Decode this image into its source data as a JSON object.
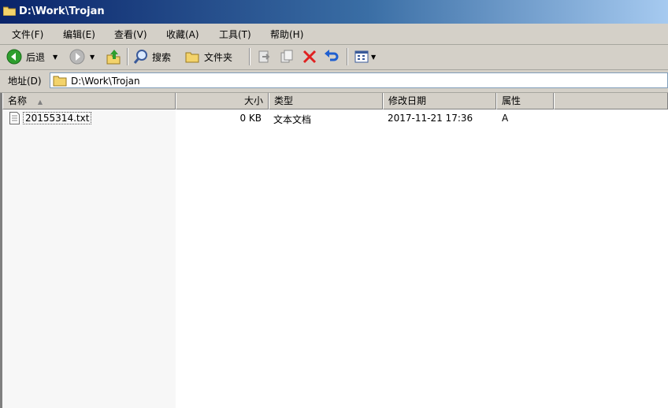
{
  "window": {
    "title": "D:\\Work\\Trojan"
  },
  "menu": [
    "文件(F)",
    "编辑(E)",
    "查看(V)",
    "收藏(A)",
    "工具(T)",
    "帮助(H)"
  ],
  "toolbar": {
    "back": "后退",
    "search": "搜索",
    "folders": "文件夹"
  },
  "address": {
    "label": "地址(D)",
    "value": "D:\\Work\\Trojan"
  },
  "columns": {
    "name": "名称",
    "size": "大小",
    "type": "类型",
    "modified": "修改日期",
    "attributes": "属性"
  },
  "files": [
    {
      "name": "20155314.txt",
      "size": "0 KB",
      "type": "文本文档",
      "modified": "2017-11-21 17:36",
      "attributes": "A"
    }
  ],
  "colors": {
    "title_start": "#0a246a",
    "title_end": "#a6caf0",
    "chrome": "#d4d0c8",
    "delete_red": "#e02020",
    "back_green": "#2e9e2e"
  },
  "icons": [
    "folder-icon",
    "back-icon",
    "forward-icon",
    "up-folder-icon",
    "search-icon",
    "folders-icon",
    "move-to-icon",
    "copy-to-icon",
    "delete-icon",
    "undo-icon",
    "views-icon",
    "text-file-icon"
  ]
}
